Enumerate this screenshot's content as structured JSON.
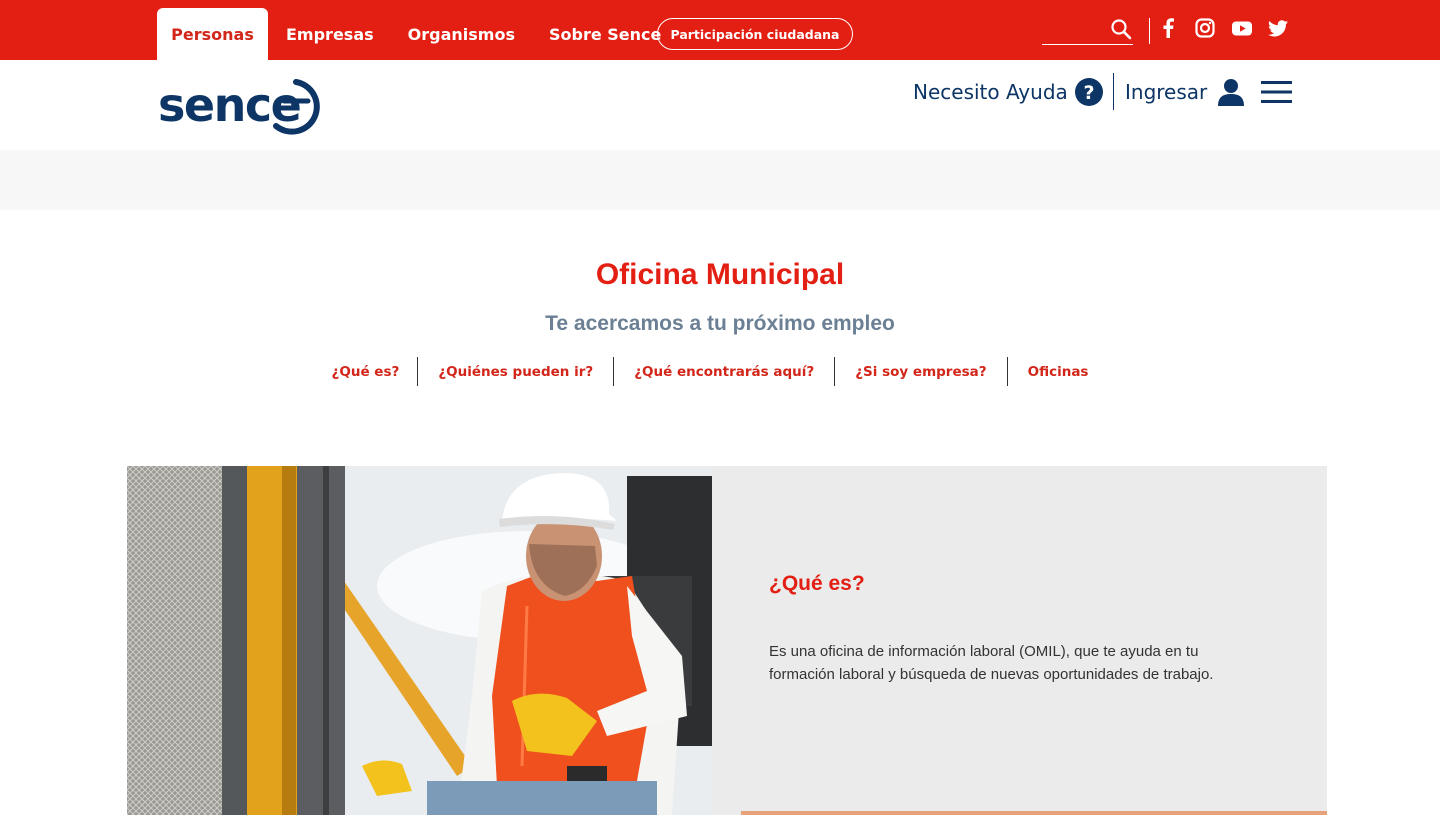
{
  "colors": {
    "brand_red": "#e31e13",
    "navy": "#0d3566",
    "subtitle_gray": "#6b8094",
    "panel_gray": "#ebebeb"
  },
  "top_nav": {
    "tabs": [
      {
        "label": "Personas",
        "active": true
      },
      {
        "label": "Empresas",
        "active": false
      },
      {
        "label": "Organismos",
        "active": false
      },
      {
        "label": "Sobre Sence",
        "active": false
      }
    ],
    "participation_button": "Participación ciudadana",
    "search": {
      "placeholder": "",
      "value": "",
      "icon": "search-icon"
    },
    "social_icons": [
      "facebook-icon",
      "instagram-icon",
      "youtube-icon",
      "twitter-icon"
    ]
  },
  "header": {
    "logo_text": "sence",
    "help_label": "Necesito Ayuda",
    "help_icon": "question-circle-icon",
    "login_label": "Ingresar",
    "login_icon": "user-icon",
    "menu_icon": "hamburger-menu-icon"
  },
  "page": {
    "title": "Oficina Municipal",
    "subtitle": "Te acercamos a tu próximo empleo",
    "section_nav": [
      "¿Qué es?",
      "¿Quiénes pueden ir?",
      "¿Qué encontrarás aquí?",
      "¿Si soy empresa?",
      "Oficinas"
    ]
  },
  "section": {
    "heading": "¿Qué es?",
    "body": "Es una oficina de información laboral (OMIL), que te ayuda en tu formación laboral y búsqueda de nuevas oportunidades de trabajo.",
    "image": "worker-in-excavator-photo"
  }
}
